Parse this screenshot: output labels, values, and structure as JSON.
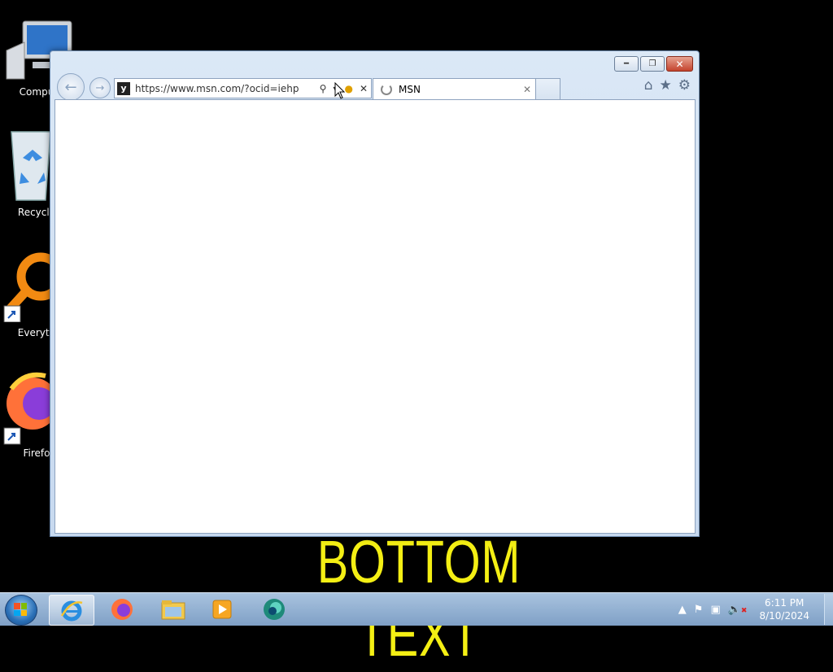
{
  "desktop": {
    "icons": [
      {
        "label": "Compu",
        "icon": "computer-icon"
      },
      {
        "label": "Recycle",
        "icon": "recycle-bin-icon"
      },
      {
        "label": "Everyth",
        "icon": "everything-search-icon"
      },
      {
        "label": "Firefo",
        "icon": "firefox-icon"
      }
    ],
    "wallpaper_text": "BOTTOM TEXT"
  },
  "browser": {
    "address": {
      "url": "https://www.msn.com/?ocid=iehp",
      "favicon": "msn-favicon-icon"
    },
    "tabs": [
      {
        "title": "MSN",
        "loading": true
      }
    ],
    "toolbar_icons": [
      "home-icon",
      "favorites-star-icon",
      "settings-gear-icon"
    ],
    "window_buttons": {
      "minimize": "minimize-icon",
      "restore": "restore-icon",
      "close": "close-icon"
    }
  },
  "taskbar": {
    "apps": [
      "internet-explorer-icon",
      "firefox-icon",
      "file-explorer-icon",
      "media-player-icon",
      "edge-icon"
    ],
    "active_app": "internet-explorer-icon",
    "clock": {
      "time": "6:11 PM",
      "date": "8/10/2024"
    }
  }
}
